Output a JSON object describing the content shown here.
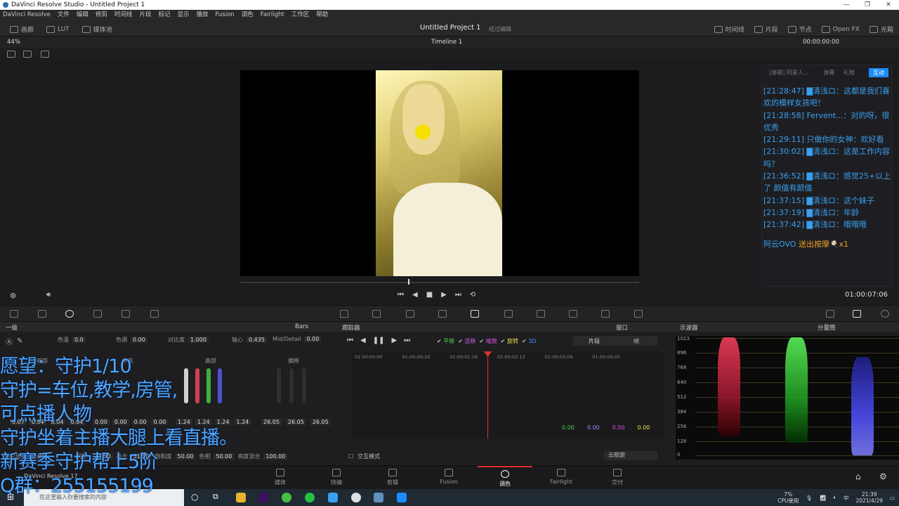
{
  "titlebar": {
    "title": "DaVinci Resolve Studio - Untitled Project 1"
  },
  "menu": [
    "DaVinci Resolve",
    "文件",
    "编辑",
    "修剪",
    "时间线",
    "片段",
    "标记",
    "显示",
    "播放",
    "Fusion",
    "调色",
    "Fairlight",
    "工作区",
    "帮助"
  ],
  "toolbar": {
    "left": [
      "画廊",
      "LUT",
      "媒体池"
    ],
    "project": "Untitled Project 1",
    "status": "经过编辑",
    "right": [
      "时间线",
      "片段",
      "节点",
      "Open FX",
      "光箱"
    ]
  },
  "viewer": {
    "zoom": "44%",
    "timeline": "Timeline 1",
    "timecode": "00:00:00:00",
    "tc2": "01:00:07:06"
  },
  "chat": {
    "header": "[弹幕] 阿星人…",
    "tab2": "弹幕",
    "tab3": "礼物",
    "button": "互动",
    "lines": [
      "[21:28:47] ▇清浅ロ：这都是我们喜",
      "欢的模样女孩吧！",
      "[21:28:58] Fervent...：对的呀，很",
      "优秀",
      "[21:29:11] 只做你的女神：欢好看",
      "[21:30:02] ▇清浅ロ：这是工作内容",
      "吗？",
      "[21:36:52] ▇清浅ロ：感觉25+以上",
      "了 颜值有颜值",
      "[21:37:15] ▇清浅ロ：这个妹子",
      "[21:37:19] ▇清浅ロ：年龄",
      "[21:37:42] ▇清浅ロ：哦哦哦"
    ],
    "gift_user": "阿云OVO",
    "gift_text": "送出按摩🍳x1"
  },
  "headers": {
    "left": "一级",
    "bars": "Bars",
    "mid": "跟踪器",
    "window": "窗口",
    "right": "示波器",
    "mode": "分量图"
  },
  "primaries": {
    "contrast_label": "对比度",
    "contrast": "1.000",
    "pivot_label": "轴心",
    "pivot": "0.435",
    "md_label": "Mid/Detail",
    "md": "0.00",
    "temp_label": "色温",
    "temp": "0.0",
    "tint_label": "色调",
    "tint": "0.00",
    "wheel_labels": [
      "暗部",
      "中灰",
      "高部",
      "偏移"
    ],
    "lift": [
      "0.07",
      "0.04",
      "0.04",
      "0.04"
    ],
    "gamma": [
      "0.00",
      "0.00",
      "0.00",
      "0.00"
    ],
    "gain": [
      "1.24",
      "1.24",
      "1.24",
      "1.24"
    ],
    "offset": [
      "26.05",
      "26.05",
      "26.05"
    ],
    "bottom": {
      "a_label": "色彩增强",
      "a": "0.00",
      "b_label": "阴影",
      "b": "-24.50",
      "c_label": "高光",
      "c": "31.50",
      "d_label": "饱和度",
      "d": "50.00",
      "e_label": "色相",
      "e": "50.00",
      "f_label": "亮度混合",
      "f": "100.00"
    }
  },
  "tracker": {
    "checks": [
      "平移",
      "竖移",
      "缩放",
      "旋转",
      "3D"
    ],
    "tabs": [
      "片段",
      "帧"
    ],
    "ruler": [
      "01:00:00:00",
      "01:00:00:20",
      "01:00:01:16",
      "01:00:02:13",
      "01:00:03:09",
      "01:00:04:05"
    ],
    "values": [
      "0.00",
      "0.00",
      "0.00",
      "0.00"
    ],
    "mode": "交互模式",
    "dropdown": "云眼跟"
  },
  "scope": {
    "ticks": [
      "1023",
      "896",
      "768",
      "640",
      "512",
      "384",
      "256",
      "128",
      "0"
    ]
  },
  "pages": [
    "媒体",
    "快编",
    "剪辑",
    "Fusion",
    "调色",
    "Fairlight",
    "交付"
  ],
  "app_label": "DaVinci Resolve 17",
  "overlay": [
    "愿望：守护1/10",
    "守护=车位,教学,房管,",
    "可点播人物",
    "守护坐着主播大腿上看直播。",
    "新赛季守护帮上5阶",
    "Q群：255155199"
  ],
  "taskbar": {
    "search": "在这里输入你要搜索的内容",
    "cpu": "7%",
    "cpu_label": "CPU使用",
    "time": "21:39",
    "date": "2021/4/29",
    "lang": "中"
  }
}
